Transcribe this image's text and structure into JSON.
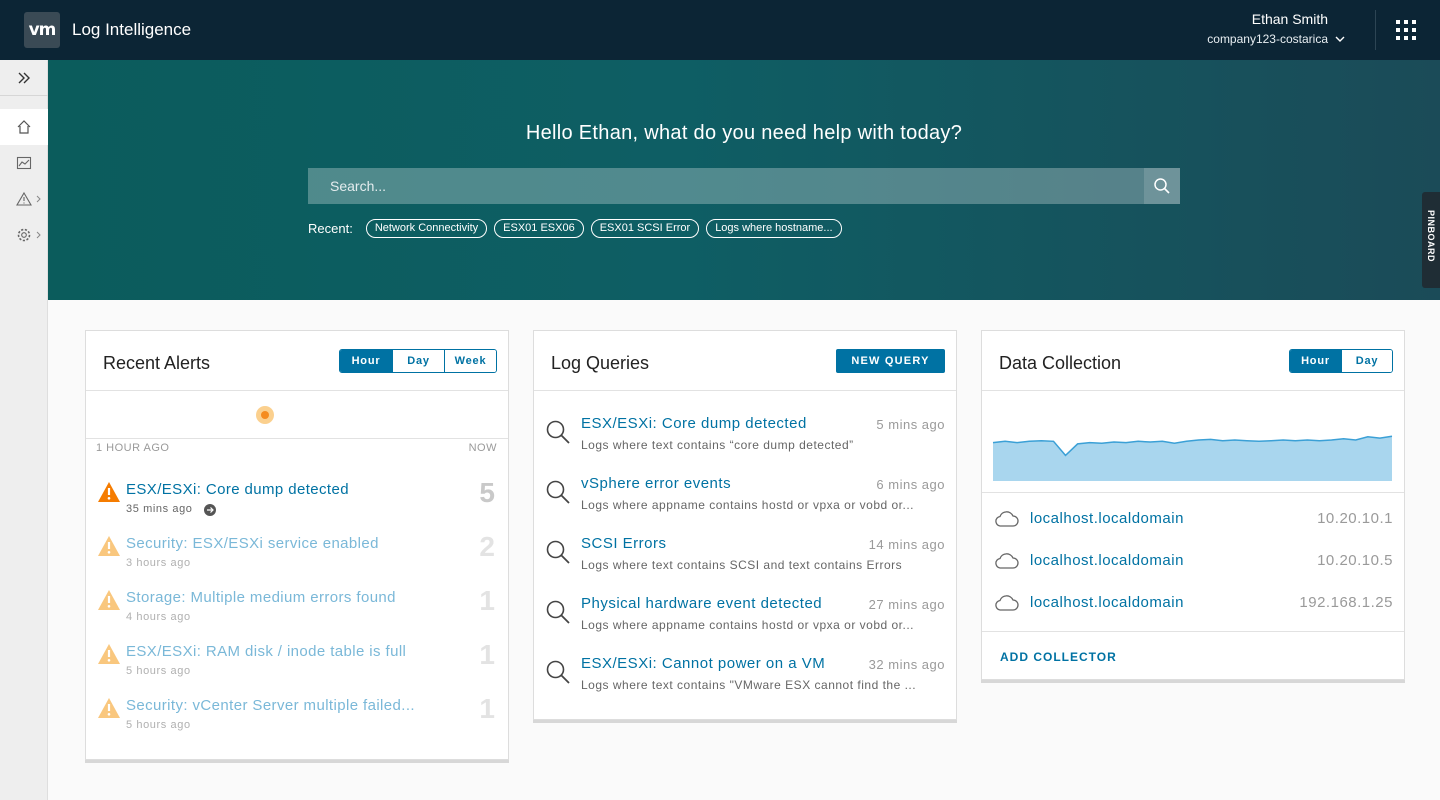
{
  "header": {
    "logo_text": "vm",
    "app_title": "Log Intelligence",
    "user_name": "Ethan Smith",
    "user_org": "company123-costarica"
  },
  "sidebar": {
    "items": [
      {
        "icon": "home-icon"
      },
      {
        "icon": "dashboard-icon"
      },
      {
        "icon": "alerts-icon"
      },
      {
        "icon": "settings-icon"
      }
    ]
  },
  "hero": {
    "greeting": "Hello Ethan, what do you need help with today?",
    "search_placeholder": "Search...",
    "recent_label": "Recent:",
    "recent_chips": [
      "Network Connectivity",
      "ESX01 ESX06",
      "ESX01 SCSI Error",
      "Logs where hostname..."
    ],
    "pinboard_label": "PINBOARD"
  },
  "alerts": {
    "title": "Recent Alerts",
    "ranges": [
      "Hour",
      "Day",
      "Week"
    ],
    "active_range": "Hour",
    "timeline_start": "1 HOUR AGO",
    "timeline_end": "NOW",
    "items": [
      {
        "title": "ESX/ESXi: Core dump detected",
        "time": "35 mins ago",
        "count": "5"
      },
      {
        "title": "Security: ESX/ESXi service enabled",
        "time": "3 hours ago",
        "count": "2"
      },
      {
        "title": "Storage: Multiple medium errors found",
        "time": "4 hours ago",
        "count": "1"
      },
      {
        "title": "ESX/ESXi: RAM disk / inode table is full",
        "time": "5 hours ago",
        "count": "1"
      },
      {
        "title": "Security: vCenter Server multiple failed...",
        "time": "5 hours ago",
        "count": "1"
      }
    ]
  },
  "queries": {
    "title": "Log Queries",
    "new_query_label": "NEW QUERY",
    "items": [
      {
        "title": "ESX/ESXi: Core dump detected",
        "time": "5 mins ago",
        "desc": "Logs where text contains “core dump detected”"
      },
      {
        "title": "vSphere error events",
        "time": "6 mins ago",
        "desc": "Logs where appname contains hostd or vpxa or vobd or..."
      },
      {
        "title": "SCSI Errors",
        "time": "14 mins ago",
        "desc": "Logs where text contains SCSI and text contains Errors"
      },
      {
        "title": "Physical hardware event detected",
        "time": "27 mins ago",
        "desc": "Logs where appname contains hostd or vpxa or vobd or..."
      },
      {
        "title": "ESX/ESXi: Cannot power on a VM",
        "time": "32 mins ago",
        "desc": "Logs where text contains \"VMware ESX cannot find the ..."
      }
    ]
  },
  "data_collection": {
    "title": "Data Collection",
    "ranges": [
      "Hour",
      "Day"
    ],
    "active_range": "Hour",
    "collectors": [
      {
        "name": "localhost.localdomain",
        "ip": "10.20.10.1"
      },
      {
        "name": "localhost.localdomain",
        "ip": "10.20.10.5"
      },
      {
        "name": "localhost.localdomain",
        "ip": "192.168.1.25"
      }
    ],
    "add_collector_label": "ADD COLLECTOR",
    "chart_data": {
      "type": "area",
      "values": [
        60,
        62,
        60,
        62,
        63,
        62,
        40,
        58,
        60,
        59,
        61,
        60,
        62,
        61,
        62,
        59,
        62,
        64,
        65,
        63,
        64,
        63,
        62,
        63,
        64,
        63,
        64,
        63,
        64,
        66,
        64,
        69,
        67,
        70
      ]
    }
  },
  "colors": {
    "header_bg": "#0c2535",
    "accent": "#0072a3",
    "warning": "#f57c00",
    "chart_fill": "#a9d6ee",
    "chart_line": "#3ba0d6"
  }
}
